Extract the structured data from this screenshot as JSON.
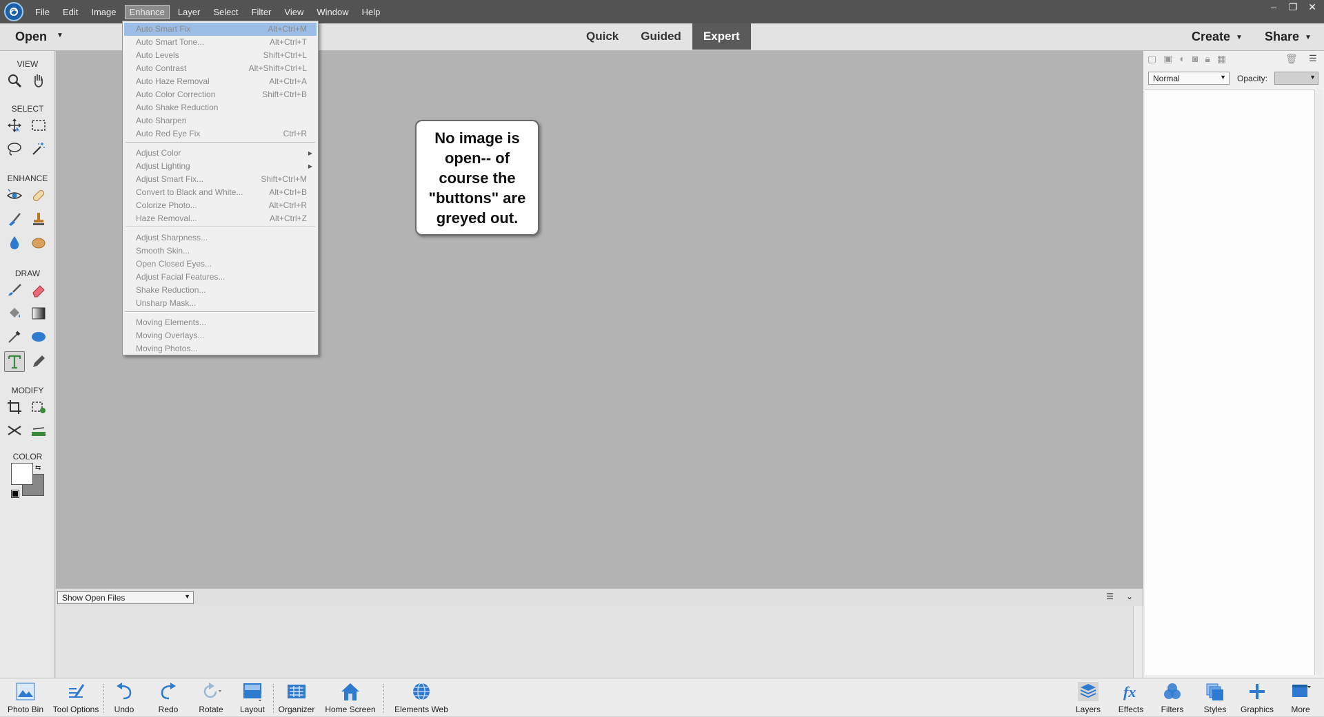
{
  "menubar": {
    "items": [
      "File",
      "Edit",
      "Image",
      "Enhance",
      "Layer",
      "Select",
      "Filter",
      "View",
      "Window",
      "Help"
    ],
    "active": "Enhance",
    "window_controls": [
      "–",
      "❐",
      "✕"
    ]
  },
  "toolbar": {
    "open_label": "Open",
    "modes": [
      "Quick",
      "Guided",
      "Expert"
    ],
    "active_mode": "Expert",
    "create_label": "Create",
    "share_label": "Share"
  },
  "left_panel": {
    "sections": [
      "VIEW",
      "SELECT",
      "ENHANCE",
      "DRAW",
      "MODIFY",
      "COLOR"
    ]
  },
  "callout": {
    "text": "No image is open-- of course the \"buttons\" are greyed out."
  },
  "bin": {
    "dropdown_value": "Show Open Files"
  },
  "right_panel": {
    "blend_mode": "Normal",
    "opacity_label": "Opacity:"
  },
  "enhance_menu": {
    "groups": [
      [
        {
          "label": "Auto Smart Fix",
          "shortcut": "Alt+Ctrl+M"
        },
        {
          "label": "Auto Smart Tone...",
          "shortcut": "Alt+Ctrl+T"
        },
        {
          "label": "Auto Levels",
          "shortcut": "Shift+Ctrl+L"
        },
        {
          "label": "Auto Contrast",
          "shortcut": "Alt+Shift+Ctrl+L"
        },
        {
          "label": "Auto Haze Removal",
          "shortcut": "Alt+Ctrl+A"
        },
        {
          "label": "Auto Color Correction",
          "shortcut": "Shift+Ctrl+B"
        },
        {
          "label": "Auto Shake Reduction",
          "shortcut": ""
        },
        {
          "label": "Auto Sharpen",
          "shortcut": ""
        },
        {
          "label": "Auto Red Eye Fix",
          "shortcut": "Ctrl+R"
        }
      ],
      [
        {
          "label": "Adjust Color",
          "shortcut": "",
          "submenu": true
        },
        {
          "label": "Adjust Lighting",
          "shortcut": "",
          "submenu": true
        },
        {
          "label": "Adjust Smart Fix...",
          "shortcut": "Shift+Ctrl+M"
        },
        {
          "label": "Convert to Black and White...",
          "shortcut": "Alt+Ctrl+B"
        },
        {
          "label": "Colorize Photo...",
          "shortcut": "Alt+Ctrl+R"
        },
        {
          "label": "Haze Removal...",
          "shortcut": "Alt+Ctrl+Z"
        }
      ],
      [
        {
          "label": "Adjust Sharpness...",
          "shortcut": ""
        },
        {
          "label": "Smooth Skin...",
          "shortcut": ""
        },
        {
          "label": "Open Closed Eyes...",
          "shortcut": ""
        },
        {
          "label": "Adjust Facial Features...",
          "shortcut": ""
        },
        {
          "label": "Shake Reduction...",
          "shortcut": ""
        },
        {
          "label": "Unsharp Mask...",
          "shortcut": ""
        }
      ],
      [
        {
          "label": "Moving Elements...",
          "shortcut": ""
        },
        {
          "label": "Moving Overlays...",
          "shortcut": ""
        },
        {
          "label": "Moving Photos...",
          "shortcut": ""
        }
      ]
    ],
    "highlighted": "Auto Smart Fix"
  },
  "taskbar": {
    "left": [
      {
        "label": "Photo Bin",
        "icon": "photo-bin-icon"
      },
      {
        "label": "Tool Options",
        "icon": "tool-options-icon"
      },
      {
        "label": "Undo",
        "icon": "undo-icon"
      },
      {
        "label": "Redo",
        "icon": "redo-icon"
      },
      {
        "label": "Rotate",
        "icon": "rotate-icon"
      },
      {
        "label": "Layout",
        "icon": "layout-icon"
      },
      {
        "label": "Organizer",
        "icon": "organizer-icon"
      },
      {
        "label": "Home Screen",
        "icon": "home-icon"
      },
      {
        "label": "Elements Web",
        "icon": "globe-icon"
      }
    ],
    "right": [
      {
        "label": "Layers",
        "icon": "layers-icon"
      },
      {
        "label": "Effects",
        "icon": "fx-icon"
      },
      {
        "label": "Filters",
        "icon": "filters-icon"
      },
      {
        "label": "Styles",
        "icon": "styles-icon"
      },
      {
        "label": "Graphics",
        "icon": "graphics-icon"
      },
      {
        "label": "More",
        "icon": "more-icon"
      }
    ]
  },
  "colors": {
    "menubar_bg": "#535353",
    "canvas_bg": "#b3b3b3",
    "menu_highlight": "#9cbde6",
    "accent_blue": "#2f7ad1"
  }
}
